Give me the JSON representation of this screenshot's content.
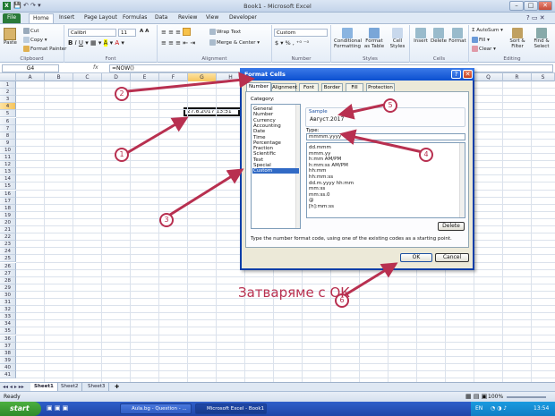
{
  "window": {
    "title": "Book1 - Microsoft Excel"
  },
  "ribbon_tabs": [
    "File",
    "Home",
    "Insert",
    "Page Layout",
    "Formulas",
    "Data",
    "Review",
    "View",
    "Developer"
  ],
  "ribbon": {
    "clipboard": {
      "paste": "Paste",
      "cut": "Cut",
      "copy": "Copy",
      "format_painter": "Format Painter",
      "label": "Clipboard"
    },
    "font": {
      "name": "Calibri",
      "size": "11",
      "label": "Font"
    },
    "alignment": {
      "wrap": "Wrap Text",
      "merge": "Merge & Center",
      "label": "Alignment"
    },
    "number": {
      "format": "Custom",
      "label": "Number"
    },
    "styles": {
      "conditional": "Conditional Formatting",
      "format_table": "Format as Table",
      "cell_styles": "Cell Styles",
      "label": "Styles"
    },
    "cells": {
      "insert": "Insert",
      "delete": "Delete",
      "format": "Format",
      "label": "Cells"
    },
    "editing": {
      "autosum": "AutoSum",
      "fill": "Fill",
      "clear": "Clear",
      "sort": "Sort & Filter",
      "find": "Find & Select",
      "label": "Editing"
    }
  },
  "formula_bar": {
    "name_box": "G4",
    "fx": "fx",
    "formula": "=NOW()"
  },
  "grid": {
    "columns": [
      "A",
      "B",
      "C",
      "D",
      "E",
      "F",
      "G",
      "H",
      "I",
      "J",
      "K",
      "L",
      "M",
      "N",
      "O",
      "P",
      "Q",
      "R",
      "S"
    ],
    "rows": [
      "1",
      "2",
      "3",
      "4",
      "5",
      "6",
      "7",
      "8",
      "9",
      "10",
      "11",
      "12",
      "13",
      "14",
      "15",
      "16",
      "17",
      "18",
      "19",
      "20",
      "21",
      "22",
      "23",
      "24",
      "25",
      "26",
      "27",
      "28",
      "29",
      "30",
      "31",
      "32",
      "33",
      "34",
      "35",
      "36",
      "37",
      "38",
      "39",
      "40",
      "41"
    ],
    "selected_value": "27.8.2017 13:51"
  },
  "sheets": [
    "Sheet1",
    "Sheet2",
    "Sheet3"
  ],
  "status": {
    "ready": "Ready",
    "zoom": "100%",
    "lang": "EN",
    "time": "13:54"
  },
  "taskbar": {
    "start": "start",
    "items": [
      "Aula.bg - Question - ...",
      "Microsoft Excel - Book1"
    ]
  },
  "dialog": {
    "title": "Format Cells",
    "tabs": [
      "Number",
      "Alignment",
      "Font",
      "Border",
      "Fill",
      "Protection"
    ],
    "category_label": "Category:",
    "categories": [
      "General",
      "Number",
      "Currency",
      "Accounting",
      "Date",
      "Time",
      "Percentage",
      "Fraction",
      "Scientific",
      "Text",
      "Special",
      "Custom"
    ],
    "selected_category": "Custom",
    "sample_label": "Sample",
    "sample_value": "Август.2017",
    "type_label": "Type:",
    "type_value": "mmmm.yyyy",
    "formats": [
      "dd.mmm",
      "mmm.yy",
      "h:mm AM/PM",
      "h:mm:ss AM/PM",
      "hh:mm",
      "hh:mm:ss",
      "dd.m.yyyy hh:mm",
      "mm:ss",
      "mm:ss.0",
      "@",
      "[h]:mm:ss"
    ],
    "delete": "Delete",
    "hint": "Type the number format code, using one of the existing codes as a starting point.",
    "ok": "OK",
    "cancel": "Cancel"
  },
  "annotations": {
    "numbers": [
      "1",
      "2",
      "3",
      "4",
      "5",
      "6"
    ],
    "caption": "Затваряме с ОК",
    "color": "#b83050"
  }
}
